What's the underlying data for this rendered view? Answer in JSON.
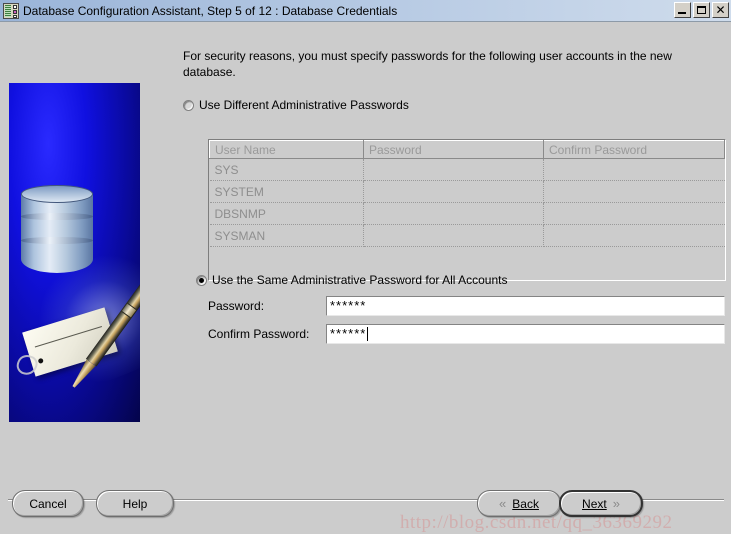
{
  "window": {
    "title": "Database Configuration Assistant, Step 5 of 12 : Database Credentials",
    "icon": "database-assistant-icon",
    "controls": {
      "minimize_label": "_",
      "maximize_label": "□",
      "close_label": "✕"
    },
    "colors": {
      "titlebar_start": "#9ab4d8",
      "titlebar_end": "#cfdcec",
      "window_background": "#cccccc",
      "sidebar_blue": "#0a0a9e",
      "disabled_text": "#9a9a9a"
    }
  },
  "sidebar": {
    "artwork_name": "database-pen-tag-illustration"
  },
  "main": {
    "instructions": "For security reasons, you must specify passwords for the following user accounts in the new database.",
    "options": [
      {
        "id": "different-passwords",
        "label": "Use Different Administrative Passwords",
        "selected": false
      },
      {
        "id": "same-password",
        "label": "Use the Same Administrative Password for All Accounts",
        "selected": true
      }
    ],
    "credentials_table": {
      "enabled": false,
      "columns": [
        "User Name",
        "Password",
        "Confirm Password"
      ],
      "rows": [
        {
          "user_name": "SYS",
          "password": "",
          "confirm_password": ""
        },
        {
          "user_name": "SYSTEM",
          "password": "",
          "confirm_password": ""
        },
        {
          "user_name": "DBSNMP",
          "password": "",
          "confirm_password": ""
        },
        {
          "user_name": "SYSMAN",
          "password": "",
          "confirm_password": ""
        }
      ]
    },
    "password_field": {
      "label": "Password:",
      "value": "******",
      "placeholder": "",
      "focused": false
    },
    "confirm_password_field": {
      "label": "Confirm Password:",
      "value": "******",
      "placeholder": "",
      "focused": true
    }
  },
  "footer": {
    "cancel_label": "Cancel",
    "help_label": "Help",
    "back_label": "Back",
    "back_icon": "«",
    "next_label": "Next",
    "next_icon": "»",
    "next_is_default": true
  },
  "overlay": {
    "watermark": "http://blog.csdn.net/qq_36369292"
  }
}
